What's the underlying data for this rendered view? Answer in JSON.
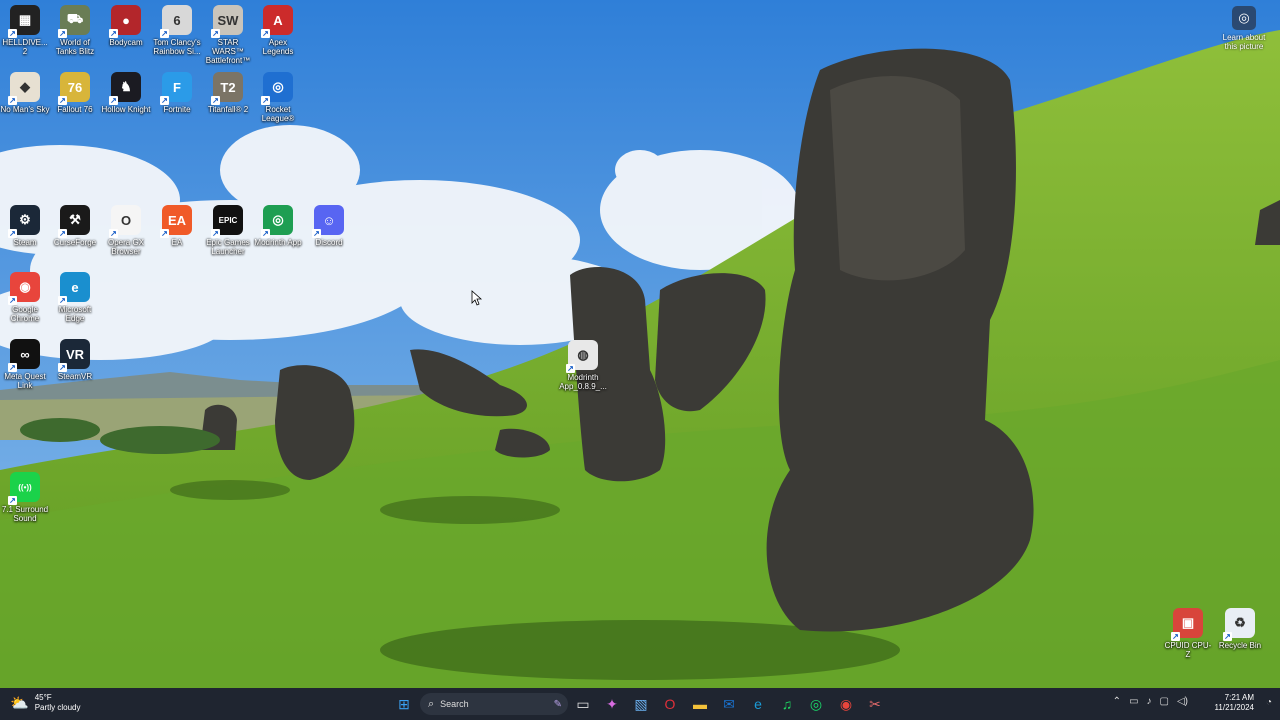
{
  "desktop": {
    "icons": [
      {
        "label": "HELLDIVE... 2",
        "glyph": "▦",
        "color": "#222222"
      },
      {
        "label": "World of Tanks Blitz",
        "glyph": "⛟",
        "color": "#6a7d55"
      },
      {
        "label": "Bodycam",
        "glyph": "●",
        "color": "#b3262b"
      },
      {
        "label": "Tom Clancy's Rainbow Si...",
        "glyph": "6",
        "color": "#d8d8d8"
      },
      {
        "label": "STAR WARS™ Battlefront™",
        "glyph": "SW",
        "color": "#c9c4bb"
      },
      {
        "label": "Apex Legends",
        "glyph": "A",
        "color": "#cc2b2b"
      },
      {
        "label": "No Man's Sky",
        "glyph": "◆",
        "color": "#e7e0d2"
      },
      {
        "label": "Fallout 76",
        "glyph": "76",
        "color": "#d8b53a"
      },
      {
        "label": "Hollow Knight",
        "glyph": "♞",
        "color": "#1b1b22"
      },
      {
        "label": "Fortnite",
        "glyph": "F",
        "color": "#2b9be8"
      },
      {
        "label": "Titanfall® 2",
        "glyph": "T2",
        "color": "#7b7466"
      },
      {
        "label": "Rocket League®",
        "glyph": "◎",
        "color": "#1f6fd1"
      },
      {
        "label": "Steam",
        "glyph": "⚙",
        "color": "#1b2838"
      },
      {
        "label": "CurseForge",
        "glyph": "⚒",
        "color": "#1a1a1a"
      },
      {
        "label": "Opera GX Browser",
        "glyph": "O",
        "color": "#f5f5f5"
      },
      {
        "label": "EA",
        "glyph": "EA",
        "color": "#f05a28"
      },
      {
        "label": "Epic Games Launcher",
        "glyph": "EPIC",
        "color": "#111111"
      },
      {
        "label": "Modrinth App",
        "glyph": "◎",
        "color": "#1e9e52"
      },
      {
        "label": "Discord",
        "glyph": "☺",
        "color": "#5865f2"
      },
      {
        "label": "Google Chrome",
        "glyph": "◉",
        "color": "#e8453c"
      },
      {
        "label": "Microsoft Edge",
        "glyph": "e",
        "color": "#1a8fcf"
      },
      {
        "label": "Meta Quest Link",
        "glyph": "∞",
        "color": "#111111"
      },
      {
        "label": "SteamVR",
        "glyph": "VR",
        "color": "#1b2838"
      },
      {
        "label": "Modrinth App_0.8.9_...",
        "glyph": "◍",
        "color": "#e8e8e8"
      },
      {
        "label": "7.1 Surround Sound",
        "glyph": "((•))",
        "color": "#1bd24a"
      },
      {
        "label": "Recycle Bin",
        "glyph": "♻",
        "color": "#e9eef5"
      },
      {
        "label": "CPUID CPU-Z",
        "glyph": "▣",
        "color": "#d8453b"
      }
    ],
    "learn_about": "Learn about this picture"
  },
  "taskbar": {
    "weather_temp": "45°F",
    "weather_desc": "Partly cloudy",
    "search_placeholder": "Search",
    "time": "7:21 AM",
    "date": "11/21/2024",
    "apps": [
      {
        "name": "start",
        "glyph": "⊞",
        "color": "#3aa0f0"
      },
      {
        "name": "task-view",
        "glyph": "▭",
        "color": "#e0e0e0"
      },
      {
        "name": "copilot",
        "glyph": "✦",
        "color": "#d86ce0"
      },
      {
        "name": "photos",
        "glyph": "▧",
        "color": "#6ab0f0"
      },
      {
        "name": "opera-gx",
        "glyph": "O",
        "color": "#e0303a"
      },
      {
        "name": "file-explorer",
        "glyph": "▬",
        "color": "#f2c13a"
      },
      {
        "name": "outlook",
        "glyph": "✉",
        "color": "#1a73d1"
      },
      {
        "name": "edge",
        "glyph": "e",
        "color": "#1a9bd7"
      },
      {
        "name": "spotify",
        "glyph": "♫",
        "color": "#1ed760"
      },
      {
        "name": "modrinth",
        "glyph": "◎",
        "color": "#1bd96a"
      },
      {
        "name": "chrome",
        "glyph": "◉",
        "color": "#e8453c"
      },
      {
        "name": "snipping-tool",
        "glyph": "✂",
        "color": "#e06a6a"
      }
    ]
  },
  "colors": {
    "accent": "#3aa0f0",
    "taskbar_bg": "#1f2530"
  }
}
